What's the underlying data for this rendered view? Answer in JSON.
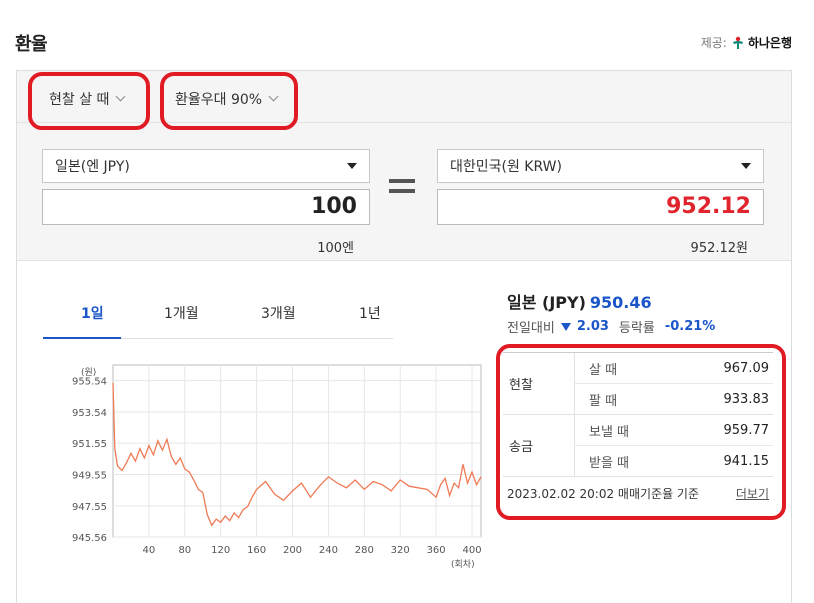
{
  "page": {
    "title": "환율"
  },
  "provider": {
    "label": "제공:",
    "name": "하나은행"
  },
  "options": {
    "rate_type": "현찰 살 때",
    "preferential": "환율우대 90%"
  },
  "converter": {
    "from_currency": "일본(엔 JPY)",
    "from_amount": "100",
    "from_sub": "100엔",
    "to_currency": "대한민국(원 KRW)",
    "to_amount": "952.12",
    "to_sub": "952.12원"
  },
  "tabs": [
    "1일",
    "1개월",
    "3개월",
    "1년"
  ],
  "summary": {
    "currency": "일본 (JPY)",
    "rate": "950.46",
    "change_label": "전일대비",
    "change_value": "2.03",
    "pct_label": "등락률",
    "pct_value": "-0.21%"
  },
  "rates": {
    "cash_label": "현찰",
    "cash_buy_label": "살 때",
    "cash_buy": "967.09",
    "cash_sell_label": "팔 때",
    "cash_sell": "933.83",
    "transfer_label": "송금",
    "send_label": "보낼 때",
    "send": "959.77",
    "receive_label": "받을 때",
    "receive": "941.15",
    "timestamp": "2023.02.02 20:02 매매기준율 기준",
    "more": "더보기"
  },
  "colors": {
    "accent": "#1a56c8",
    "down": "#1a56c8",
    "up": "#e0252e",
    "line": "#f07a55",
    "highlight": "#e01b24"
  },
  "chart_data": {
    "type": "line",
    "ylabel": "(원)",
    "xlabel": "(회차)",
    "yticks": [
      "955.54",
      "953.54",
      "951.55",
      "949.55",
      "947.55",
      "945.56"
    ],
    "xticks": [
      40,
      80,
      120,
      160,
      200,
      240,
      280,
      320,
      360,
      400
    ],
    "ylim": [
      945.56,
      956.54
    ],
    "xlim": [
      0,
      410
    ],
    "series": [
      {
        "x": [
          0,
          2,
          5,
          10,
          15,
          20,
          25,
          30,
          35,
          40,
          45,
          50,
          55,
          60,
          65,
          70,
          75,
          80,
          85,
          90,
          95,
          100,
          105,
          110,
          115,
          120,
          125,
          130,
          135,
          140,
          145,
          150,
          155,
          160,
          170,
          180,
          190,
          200,
          210,
          220,
          230,
          240,
          250,
          260,
          270,
          280,
          290,
          300,
          310,
          320,
          330,
          340,
          350,
          360,
          365,
          370,
          375,
          380,
          385,
          390,
          395,
          400,
          405,
          410
        ],
        "y": [
          955.4,
          951.2,
          950.1,
          949.8,
          950.3,
          950.9,
          950.4,
          951.2,
          950.6,
          951.4,
          950.8,
          951.7,
          951.1,
          951.8,
          950.7,
          950.2,
          950.6,
          949.9,
          949.7,
          949.2,
          948.6,
          948.4,
          947.0,
          946.3,
          946.7,
          946.5,
          946.9,
          946.6,
          947.1,
          946.8,
          947.3,
          947.5,
          948.1,
          948.6,
          949.1,
          948.3,
          947.9,
          948.5,
          949.0,
          948.1,
          948.8,
          949.4,
          949.0,
          948.7,
          949.2,
          948.6,
          949.1,
          948.9,
          948.5,
          949.2,
          948.8,
          948.7,
          948.6,
          948.1,
          948.9,
          949.3,
          948.2,
          949.0,
          948.7,
          950.2,
          949.0,
          949.7,
          948.9,
          949.4
        ]
      }
    ]
  }
}
